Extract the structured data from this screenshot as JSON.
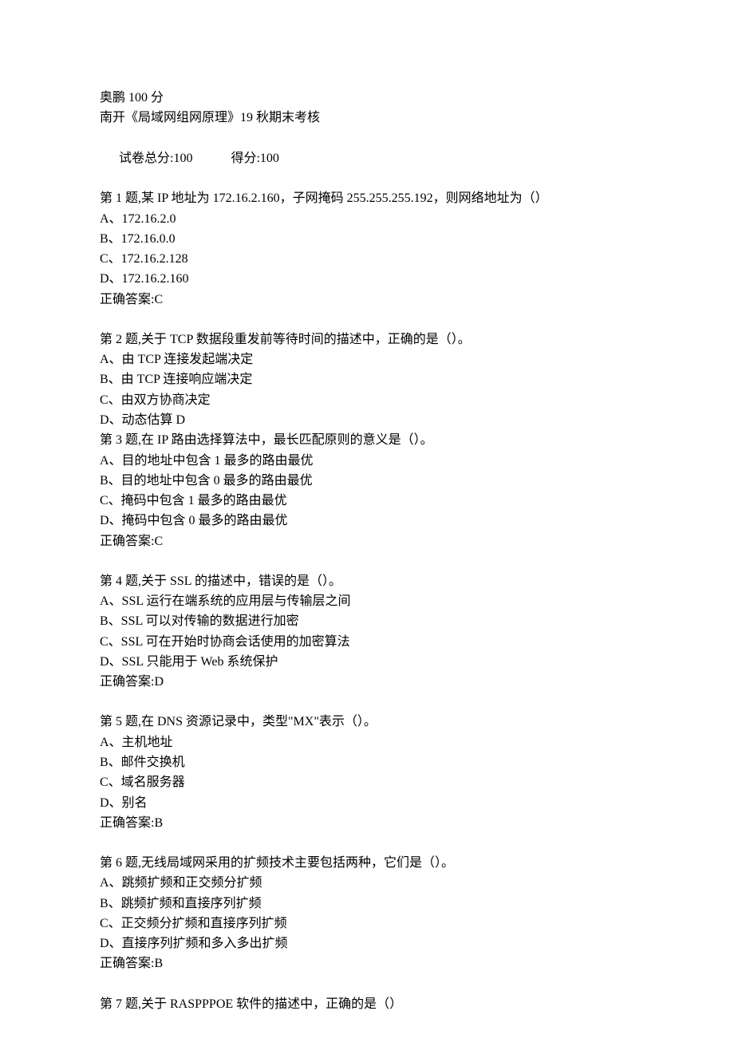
{
  "header": {
    "title_line": "奥鹏 100 分",
    "course_line": "南开《局域网组网原理》19 秋期末考核",
    "score_label": "试卷总分:100",
    "score_got": "得分:100"
  },
  "questions": [
    {
      "stem": "第 1 题,某 IP 地址为 172.16.2.160，子网掩码 255.255.255.192，则网络地址为（）",
      "options": [
        "A、172.16.2.0",
        "B、172.16.0.0",
        "C、172.16.2.128",
        "D、172.16.2.160"
      ],
      "answer": "正确答案:C",
      "gap_after": true
    },
    {
      "stem": "第 2 题,关于 TCP 数据段重发前等待时间的描述中，正确的是（）。",
      "options": [
        "A、由 TCP 连接发起端决定",
        "B、由 TCP 连接响应端决定",
        "C、由双方协商决定",
        "D、动态估算 D"
      ],
      "answer": "",
      "gap_after": false
    },
    {
      "stem": "第 3 题,在 IP 路由选择算法中，最长匹配原则的意义是（）。",
      "options": [
        "A、目的地址中包含 1 最多的路由最优",
        "B、目的地址中包含 0 最多的路由最优",
        "C、掩码中包含 1 最多的路由最优",
        "D、掩码中包含 0 最多的路由最优"
      ],
      "answer": "正确答案:C",
      "gap_after": true
    },
    {
      "stem": "第 4 题,关于 SSL 的描述中，错误的是（）。",
      "options": [
        "A、SSL 运行在端系统的应用层与传输层之间",
        "B、SSL 可以对传输的数据进行加密",
        "C、SSL 可在开始时协商会话使用的加密算法",
        "D、SSL 只能用于 Web 系统保护"
      ],
      "answer": "正确答案:D",
      "gap_after": true
    },
    {
      "stem": "第 5 题,在 DNS 资源记录中，类型\"MX\"表示（）。",
      "options": [
        "A、主机地址",
        "B、邮件交换机",
        "C、域名服务器",
        "D、别名"
      ],
      "answer": "正确答案:B",
      "gap_after": true
    },
    {
      "stem": "第 6 题,无线局域网采用的扩频技术主要包括两种，它们是（）。",
      "options": [
        "A、跳频扩频和正交频分扩频",
        "B、跳频扩频和直接序列扩频",
        "C、正交频分扩频和直接序列扩频",
        "D、直接序列扩频和多入多出扩频"
      ],
      "answer": "正确答案:B",
      "gap_after": true
    },
    {
      "stem": "第 7 题,关于 RASPPPOE 软件的描述中，正确的是（）",
      "options": [],
      "answer": "",
      "gap_after": false
    }
  ]
}
